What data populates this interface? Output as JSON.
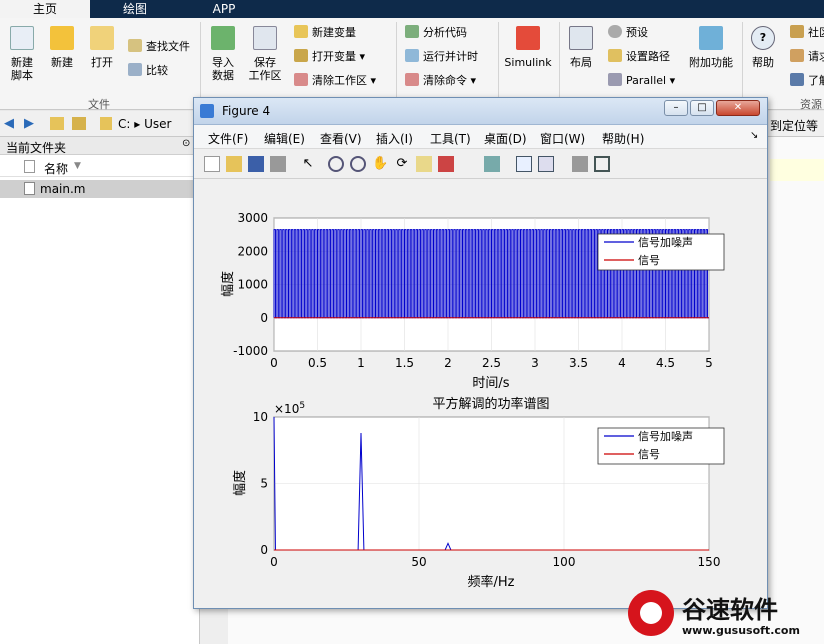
{
  "tabs": [
    "主页",
    "绘图",
    "APP"
  ],
  "ribbon": {
    "new_script": "新建\n脚本",
    "new": "新建",
    "open": "打开",
    "find_files": "查找文件",
    "compare": "比较",
    "group_file": "文件",
    "import": "导入\n数据",
    "save_ws": "保存\n工作区",
    "new_var": "新建变量",
    "open_var": "打开变量",
    "clear_ws": "清除工作区",
    "analyze": "分析代码",
    "run_time": "运行并计时",
    "clear_cmd": "清除命令",
    "simulink": "Simulink",
    "layout": "布局",
    "prefs": "预设",
    "set_path": "设置路径",
    "parallel": "Parallel",
    "addons": "附加功能",
    "help": "帮助",
    "community": "社区",
    "request": "请求",
    "learn": "了解",
    "group_resources": "资源"
  },
  "address": {
    "path": "C: ▸ User",
    "hint": "到定位等目"
  },
  "leftpanel": {
    "title": "当前文件夹",
    "col_name": "名称",
    "files": [
      "main.m"
    ]
  },
  "figure": {
    "title": "Figure 4",
    "menus": [
      "文件(F)",
      "编辑(E)",
      "查看(V)",
      "插入(I)",
      "工具(T)",
      "桌面(D)",
      "窗口(W)",
      "帮助(H)"
    ]
  },
  "chart_data": [
    {
      "type": "line",
      "title": "",
      "xlabel": "时间/s",
      "ylabel": "幅度",
      "xlim": [
        0,
        5
      ],
      "ylim": [
        -1000,
        3000
      ],
      "xticks": [
        "0",
        "0.5",
        "1",
        "1.5",
        "2",
        "2.5",
        "3",
        "3.5",
        "4",
        "4.5",
        "5"
      ],
      "yticks": [
        "-1000",
        "0",
        "1000",
        "2000",
        "3000"
      ],
      "grid": true,
      "legend_position": "top-right",
      "series": [
        {
          "name": "信号加噪声",
          "color": "#0000cc",
          "pattern": "square_wave",
          "low": 0,
          "high": 2650,
          "periods": 150
        },
        {
          "name": "信号",
          "color": "#cc0000",
          "pattern": "constant",
          "value": 0
        }
      ]
    },
    {
      "type": "line",
      "title": "平方解调的功率谱图",
      "xlabel": "频率/Hz",
      "ylabel": "幅度",
      "xlim": [
        0,
        150
      ],
      "ylim": [
        0,
        10
      ],
      "y_multiplier": "×10^5",
      "xticks": [
        "0",
        "50",
        "100",
        "150"
      ],
      "yticks": [
        "0",
        "5",
        "10"
      ],
      "grid": true,
      "legend_position": "top-right",
      "series": [
        {
          "name": "信号加噪声",
          "color": "#0000cc",
          "x": [
            0,
            0.5,
            1,
            29,
            30,
            31,
            59,
            60,
            61,
            150
          ],
          "y": [
            10,
            0,
            0,
            0,
            8.8,
            0,
            0,
            0.5,
            0,
            0
          ]
        },
        {
          "name": "信号",
          "color": "#cc0000",
          "x": [
            0,
            150
          ],
          "y": [
            0,
            0
          ]
        }
      ]
    }
  ],
  "watermark": {
    "brand": "谷速软件",
    "url": "www.gususoft.com"
  },
  "colors": {
    "blue": "#0000cc",
    "red": "#cc0000",
    "tabbar": "#0e2a4a"
  }
}
